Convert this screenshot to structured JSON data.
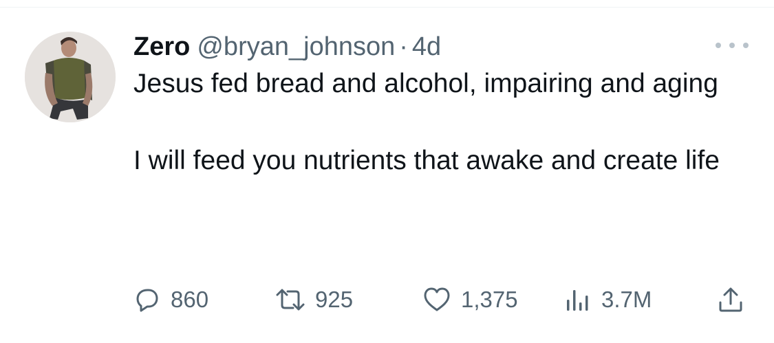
{
  "tweet": {
    "author": {
      "display_name": "Zero",
      "handle": "@bryan_johnson",
      "separator": "·",
      "time": "4d"
    },
    "text": [
      "Jesus fed bread and alcohol, impairing and aging",
      "I will feed you nutrients that awake and create life"
    ],
    "icons": {
      "more": "more-horizontal-icon",
      "reply": "reply-icon",
      "retweet": "retweet-icon",
      "like": "heart-icon",
      "views": "views-bar-chart-icon",
      "share": "share-icon"
    },
    "metrics": {
      "replies": "860",
      "retweets": "925",
      "likes": "1,375",
      "views": "3.7M"
    }
  },
  "colors": {
    "text_primary": "#0f1419",
    "text_secondary": "#536471",
    "divider": "#eff3f4"
  }
}
